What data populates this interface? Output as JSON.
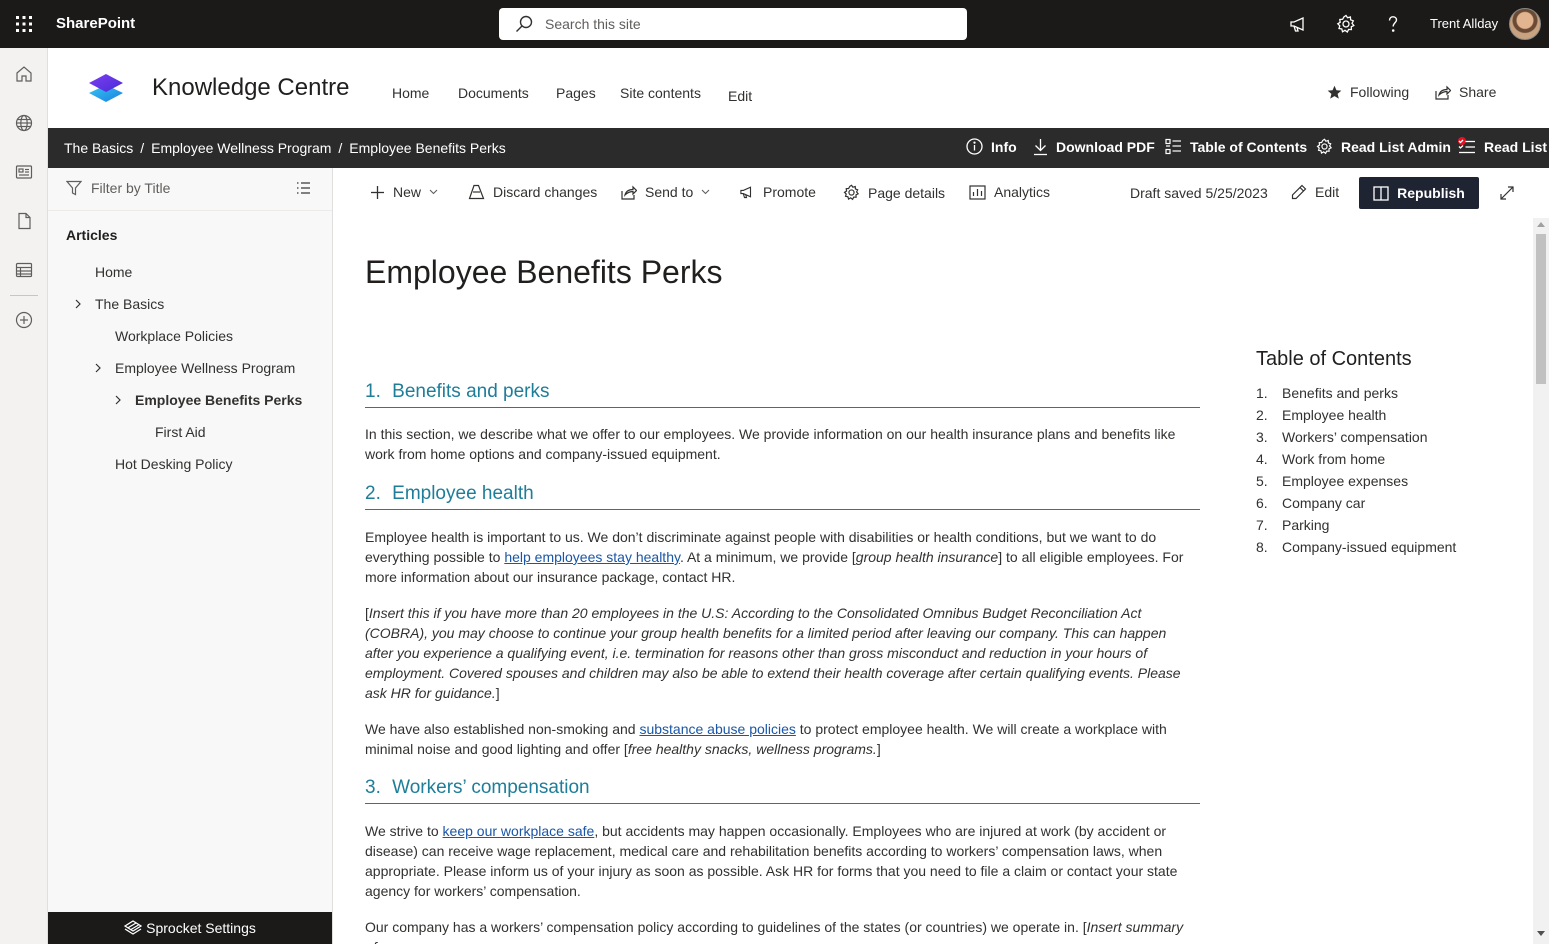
{
  "suite": {
    "app_name": "SharePoint",
    "search_placeholder": "Search this site",
    "user_name": "Trent Allday",
    "icons": [
      "waffle-icon",
      "megaphone-icon",
      "settings-icon",
      "help-icon"
    ]
  },
  "site": {
    "title": "Knowledge Centre",
    "nav": [
      "Home",
      "Documents",
      "Pages",
      "Site contents",
      "Edit"
    ],
    "following_label": "Following",
    "share_label": "Share"
  },
  "darkbar": {
    "breadcrumb": [
      "The Basics",
      "Employee Wellness Program",
      "Employee Benefits Perks"
    ],
    "separator": "/",
    "actions": [
      "Info",
      "Download PDF",
      "Table of Contents",
      "Read List Admin",
      "Read List"
    ]
  },
  "leftnav": {
    "filter_placeholder": "Filter by Title",
    "heading": "Articles",
    "items": [
      "Home",
      "The Basics",
      "Workplace Policies",
      "Employee Wellness Program",
      "Employee Benefits Perks",
      "First Aid",
      "Hot Desking Policy"
    ],
    "footer": "Sprocket Settings"
  },
  "commandbar": {
    "new": "New",
    "discard": "Discard changes",
    "send_to": "Send to",
    "promote": "Promote",
    "page_details": "Page details",
    "analytics": "Analytics",
    "draft_saved": "Draft saved 5/25/2023",
    "edit": "Edit",
    "republish": "Republish"
  },
  "page": {
    "title": "Employee Benefits Perks",
    "sections": [
      {
        "num": "1.",
        "title": "Benefits and perks"
      },
      {
        "num": "2.",
        "title": "Employee health"
      },
      {
        "num": "3.",
        "title": "Workers’ compensation"
      }
    ],
    "s1_p1": "In this section, we describe what we offer to our employees. We provide information on our health insurance plans and benefits like work from home options and company-issued equipment.",
    "s2_p1_a": "Employee health is important to us. We don’t discriminate against people with disabilities or health conditions, but we want to do everything possible to ",
    "s2_p1_link": "help employees stay healthy",
    "s2_p1_b": ". At a minimum, we provide [",
    "s2_p1_em": "group health insurance",
    "s2_p1_c": "] to all eligible employees. For more information about our insurance package, contact HR.",
    "s2_p2_a": "[",
    "s2_p2_em": "Insert this if you have more than 20 employees in the U.S: According to the Consolidated Omnibus Budget Reconciliation Act (COBRA), you may choose to continue your group health benefits for a limited period after leaving our company. This can happen after you experience a qualifying event, i.e. termination for reasons other than gross misconduct and reduction in your hours of employment. Covered spouses and children may also be able to extend their health coverage after certain qualifying events. Please ask HR for guidance.",
    "s2_p2_b": "]",
    "s2_p3_a": "We have also established non-smoking and ",
    "s2_p3_link": "substance abuse policies",
    "s2_p3_b": " to protect employee health. We will create a workplace with minimal noise and good lighting and offer [",
    "s2_p3_em": "free healthy snacks, wellness programs.",
    "s2_p3_c": "]",
    "s3_p1_a": "We strive to ",
    "s3_p1_link": "keep our workplace safe",
    "s3_p1_b": ", but accidents may happen occasionally. Employees who are injured at work (by accident or disease) can receive wage replacement, medical care and rehabilitation benefits according to workers’ compensation laws, when appropriate. Please inform us of your injury as soon as possible. Ask HR for forms that you need to file a claim or contact your state agency for workers’ compensation.",
    "s3_p2_a": "Our company has a workers’ compensation policy according to guidelines of the states (or countries) we operate in. [",
    "s3_p2_em": "Insert summary of"
  },
  "toc": {
    "title": "Table of Contents",
    "items": [
      {
        "n": "1.",
        "label": "Benefits and perks"
      },
      {
        "n": "2.",
        "label": "Employee health"
      },
      {
        "n": "3.",
        "label": "Workers’ compensation"
      },
      {
        "n": "4.",
        "label": "Work from home"
      },
      {
        "n": "5.",
        "label": "Employee expenses"
      },
      {
        "n": "6.",
        "label": "Company car"
      },
      {
        "n": "7.",
        "label": "Parking"
      },
      {
        "n": "8.",
        "label": "Company-issued equipment"
      }
    ]
  },
  "colors": {
    "suite_bar": "#1b1a19",
    "dark_bar": "#2b2b2b",
    "heading_teal": "#1e7d99",
    "link_blue": "#1a56a6",
    "republish_bg": "#1f2433",
    "notification_dot": "#e81123"
  }
}
